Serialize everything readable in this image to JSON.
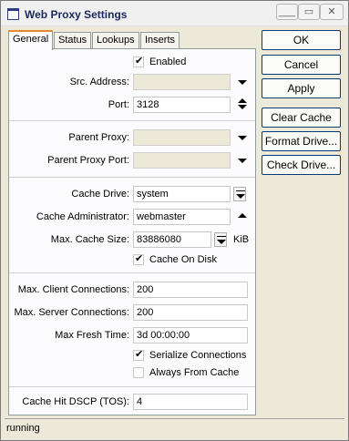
{
  "window": {
    "title": "Web Proxy Settings"
  },
  "titlebar_buttons": {
    "minimize": "___",
    "restore": "▭",
    "close": "✕"
  },
  "tabs": [
    {
      "label": "General"
    },
    {
      "label": "Status"
    },
    {
      "label": "Lookups"
    },
    {
      "label": "Inserts"
    }
  ],
  "general": {
    "enabled_label": "Enabled",
    "src_address_label": "Src. Address:",
    "src_address_value": "",
    "port_label": "Port:",
    "port_value": "3128",
    "parent_proxy_label": "Parent Proxy:",
    "parent_proxy_value": "",
    "parent_proxy_port_label": "Parent Proxy Port:",
    "parent_proxy_port_value": "",
    "cache_drive_label": "Cache Drive:",
    "cache_drive_value": "system",
    "cache_admin_label": "Cache Administrator:",
    "cache_admin_value": "webmaster",
    "max_cache_size_label": "Max. Cache Size:",
    "max_cache_size_value": "83886080",
    "max_cache_size_unit": "KiB",
    "cache_on_disk_label": "Cache On Disk",
    "max_client_conn_label": "Max. Client Connections:",
    "max_client_conn_value": "200",
    "max_server_conn_label": "Max. Server Connections:",
    "max_server_conn_value": "200",
    "max_fresh_time_label": "Max Fresh Time:",
    "max_fresh_time_value": "3d 00:00:00",
    "serialize_label": "Serialize Connections",
    "always_from_cache_label": "Always From Cache",
    "cache_hit_dscp_label": "Cache Hit DSCP (TOS):",
    "cache_hit_dscp_value": "4"
  },
  "checkbox_states": {
    "enabled": true,
    "cache_on_disk": true,
    "serialize": true,
    "always_from_cache": false
  },
  "buttons": {
    "ok": "OK",
    "cancel": "Cancel",
    "apply": "Apply",
    "clear_cache": "Clear Cache",
    "format_drive": "Format Drive...",
    "check_drive": "Check Drive..."
  },
  "status": "running"
}
